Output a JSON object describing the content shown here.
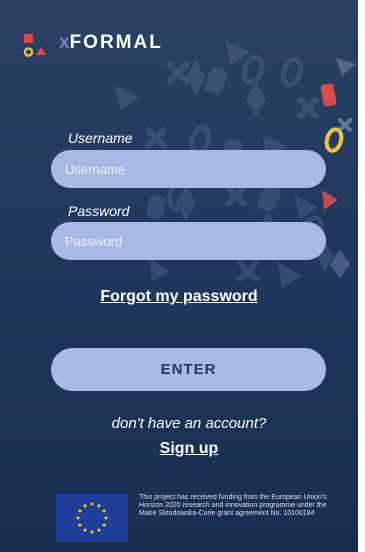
{
  "brand": {
    "name": "FORMAL",
    "x_prefix": "x",
    "colors": {
      "accent_red": "#d94b4b",
      "accent_yellow": "#f2c13f",
      "accent_purple": "#7f7ec9"
    }
  },
  "login": {
    "username_label": "Username",
    "username_placeholder": "Username",
    "password_label": "Password",
    "password_placeholder": "Password",
    "forgot_link": "Forgot my password",
    "enter_button": "ENTER",
    "no_account_text": "don't have an account?",
    "signup_link": "Sign up"
  },
  "footer": {
    "funding_text": "This project has received funding from the European Union's Horizon 2020 research and innovation programme under the Marie Sktodowska-Curie grant agreement No. 10100184"
  },
  "theme": {
    "background_top": "#2a4165",
    "background_bottom": "#182e52",
    "field_color": "#a9b9e6",
    "eu_blue": "#1e3f9a",
    "eu_star": "#ffd200"
  }
}
